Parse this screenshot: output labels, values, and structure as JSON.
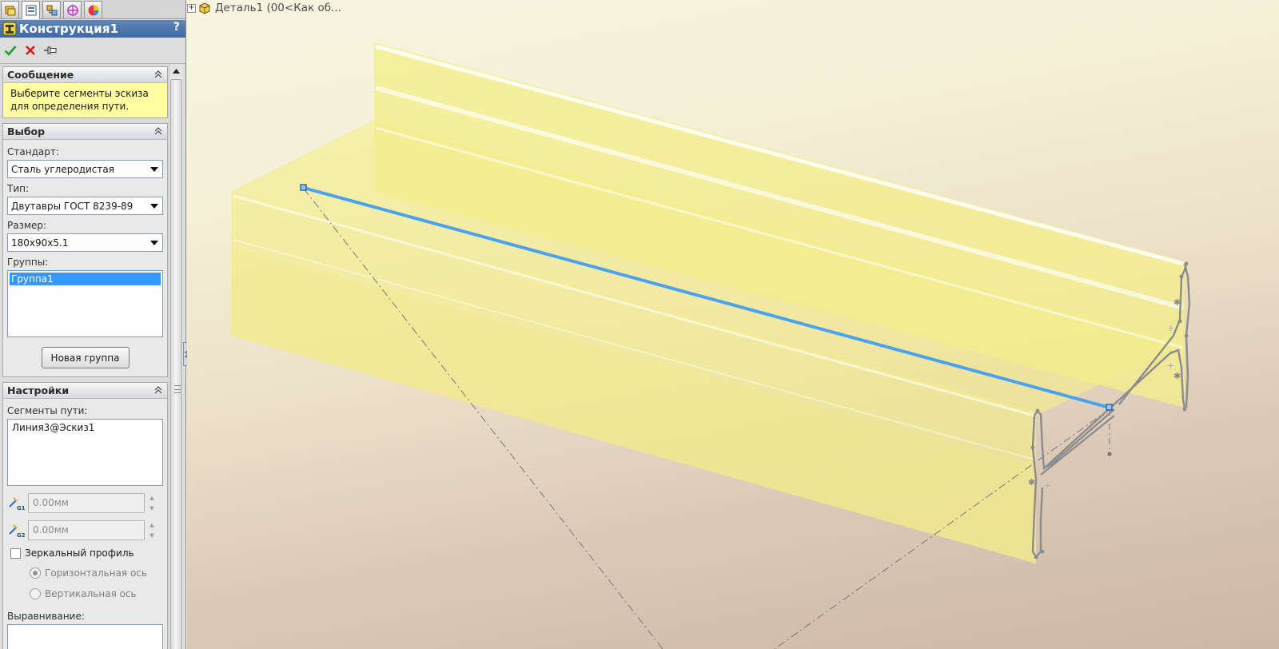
{
  "tabs": [
    {
      "name": "feature-manager-tab",
      "icon": "feature-tree-icon"
    },
    {
      "name": "property-manager-tab",
      "icon": "property-manager-icon"
    },
    {
      "name": "configuration-manager-tab",
      "icon": "configuration-icon"
    },
    {
      "name": "dimxpert-tab",
      "icon": "dimxpert-target-icon"
    },
    {
      "name": "display-manager-tab",
      "icon": "display-manager-icon"
    }
  ],
  "property_manager": {
    "title": "Конструкция1",
    "help": "?"
  },
  "message": {
    "header": "Сообщение",
    "text": "Выберите сегменты эскиза для определения пути."
  },
  "selection": {
    "header": "Выбор",
    "standard_label": "Стандарт:",
    "standard_value": "Сталь углеродистая",
    "type_label": "Тип:",
    "type_value": "Двутавры ГОСТ 8239-89",
    "size_label": "Размер:",
    "size_value": "180x90x5.1",
    "groups_label": "Группы:",
    "groups": [
      "Группа1"
    ],
    "new_group_button": "Новая группа"
  },
  "settings": {
    "header": "Настройки",
    "path_segments_label": "Сегменты пути:",
    "path_segments": [
      "Линия3@Эскиз1"
    ],
    "gap1_value": "0.00мм",
    "gap2_value": "0.00мм",
    "mirror_profile_label": "Зеркальный профиль",
    "horizontal_axis_label": "Горизонтальная ось",
    "vertical_axis_label": "Вертикальная ось",
    "alignment_label": "Выравнивание:"
  },
  "viewport": {
    "tree_label": "Деталь1  (00<Как об...",
    "colors": {
      "beam_fill": "#f3ee8c",
      "beam_edge": "#ffffff",
      "path_line": "#4aa3ee",
      "profile_stroke": "#8c8c8c"
    }
  }
}
